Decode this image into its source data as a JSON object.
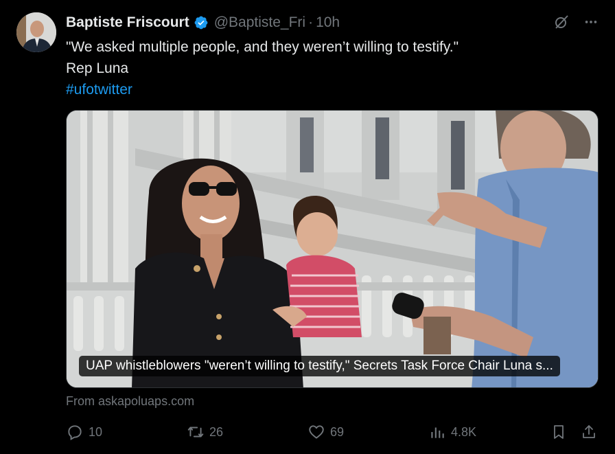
{
  "author": {
    "name": "Baptiste Friscourt",
    "handle": "@Baptiste_Fri",
    "separator": "·",
    "time": "10h"
  },
  "post": {
    "line1": "\"We asked multiple people, and they weren’t willing to testify.\"",
    "line2": "Rep Luna",
    "hashtag": "#ufotwitter"
  },
  "media": {
    "caption": "UAP whistleblowers \"weren’t willing to testify,\" Secrets Task Force Chair Luna s..."
  },
  "source": "From askapoluaps.com",
  "actions": {
    "replies": "10",
    "reposts": "26",
    "likes": "69",
    "views": "4.8K"
  },
  "icons": {
    "verified": "verified-badge-icon",
    "grok": "grok-icon",
    "more": "more-icon",
    "reply": "reply-icon",
    "repost": "repost-icon",
    "like": "heart-icon",
    "views": "views-icon",
    "bookmark": "bookmark-icon",
    "share": "share-icon"
  },
  "colors": {
    "background": "#000000",
    "text": "#e7e9ea",
    "muted": "#71767b",
    "accent": "#1d9bf0"
  }
}
